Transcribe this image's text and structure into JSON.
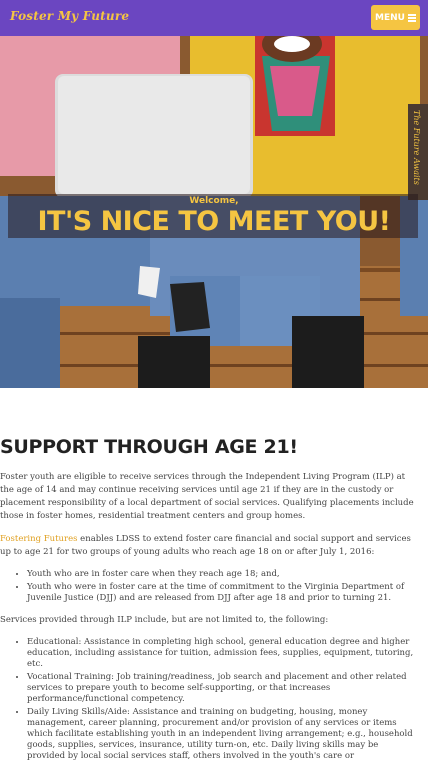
{
  "header": {
    "logo_text": "Foster My Future",
    "menu_label": "MENU"
  },
  "hero": {
    "side_tab_text": "The Future Awaits",
    "welcome": "Welcome,",
    "title": "IT'S NICE TO MEET YOU!"
  },
  "main": {
    "heading": "SUPPORT THROUGH AGE 21!",
    "intro": "Foster youth are eligible to receive services through the Independent Living Program (ILP) at the age of 14 and may continue receiving services until age 21 if they are in the custody or placement responsibility of a local department of social services. Qualifying placements include those in foster homes, residential treatment centers and group homes.",
    "fostering_link": "Fostering Futures",
    "fostering_text": " enables LDSS to extend foster care financial and social support and services up to age 21 for two groups of young adults who reach age 18 on or after July 1, 2016:",
    "groups": [
      "Youth who are in foster care when they reach age 18; and,",
      "Youth who were in foster care at the time of commitment to the Virginia Department of Juvenile Justice (DJJ) and are released from DJJ after age 18 and prior to turning 21."
    ],
    "services_intro": "Services provided through ILP include, but are not limited to, the following:",
    "services": [
      "Educational: Assistance in completing high school, general education degree and higher education, including assistance for tuition, admission fees, supplies, equipment, tutoring, etc.",
      "Vocational Training: Job training/readiness, job search and placement and other related services to prepare youth to become self-supporting, or that increases performance/functional competency.",
      "Daily Living Skills/Aide: Assistance and training on budgeting, housing, money management, career planning, procurement and/or provision of any services or items which facilitate establishing youth in an independent living arrangement; e.g., household goods, supplies, services, insurance, utility turn-on, etc. Daily living skills may be provided by local social services staff, others involved in the youth's care or"
    ]
  },
  "colors": {
    "header_bg": "#6b46c1",
    "accent": "#f5c542",
    "link": "#e0a020"
  }
}
